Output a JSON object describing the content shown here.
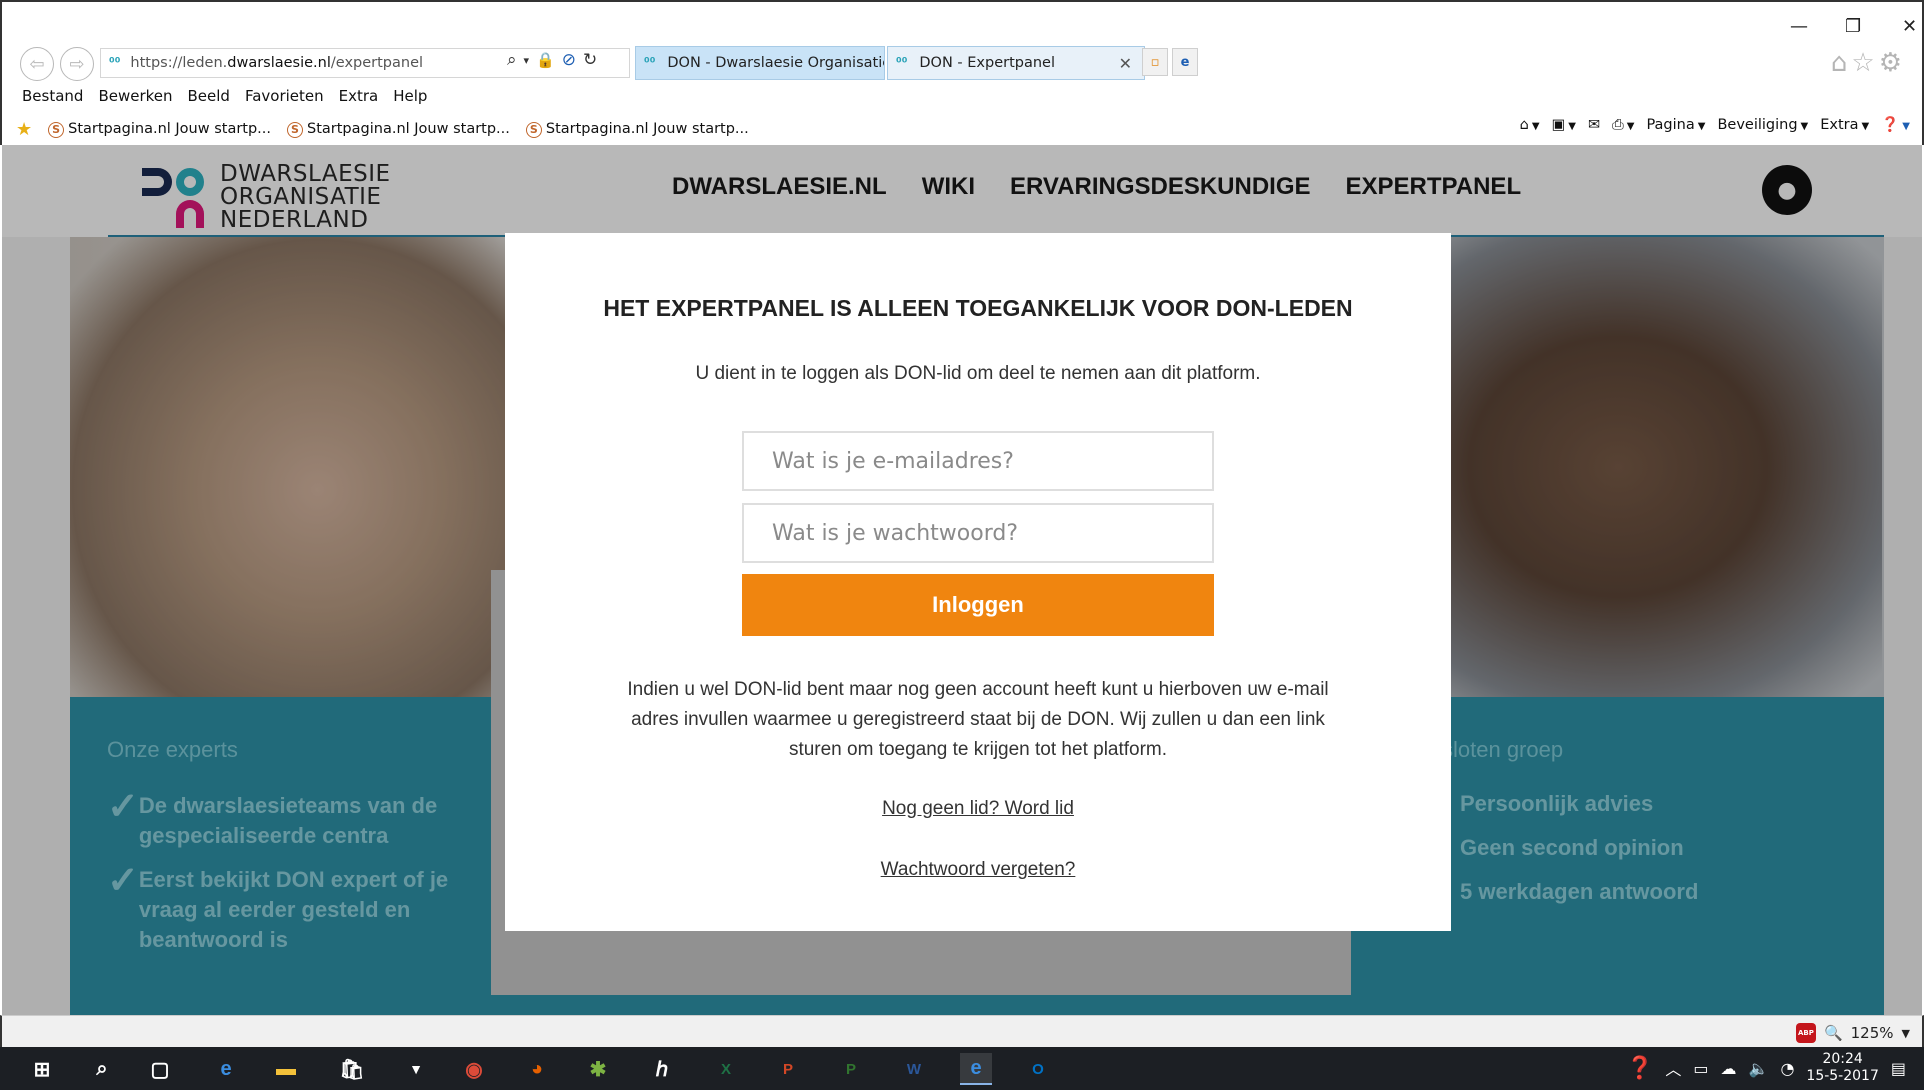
{
  "browser": {
    "url_prefix": "https://leden.",
    "url_host": "dwarslaesie.nl",
    "url_path": "/expertpanel",
    "tabs": [
      {
        "label": "DON - Dwarslaesie Organisatie..."
      },
      {
        "label": "DON - Expertpanel"
      }
    ],
    "menu": [
      "Bestand",
      "Bewerken",
      "Beeld",
      "Favorieten",
      "Extra",
      "Help"
    ],
    "favorites": [
      "Startpagina.nl  Jouw startp...",
      "Startpagina.nl  Jouw startp...",
      "Startpagina.nl  Jouw startp..."
    ],
    "commands": {
      "page": "Pagina",
      "security": "Beveiliging",
      "extra": "Extra"
    },
    "zoom": "125%"
  },
  "site": {
    "logo_lines": [
      "DWARSLAESIE",
      "ORGANISATIE",
      "NEDERLAND"
    ],
    "nav": [
      "DWARSLAESIE.NL",
      "WIKI",
      "ERVARINGSDESKUNDIGE",
      "EXPERTPANEL"
    ]
  },
  "background": {
    "left_title": "Onze experts",
    "left_items": [
      "De dwarslaesieteams van de gespecialiseerde centra",
      "Eerst bekijkt DON expert of je vraag al eerder gesteld en beantwoord is"
    ],
    "right_title_partial": "sloten groep",
    "right_items": [
      "Persoonlijk advies",
      "Geen second opinion",
      "5 werkdagen antwoord"
    ]
  },
  "modal": {
    "title": "HET EXPERTPANEL IS ALLEEN TOEGANKELIJK VOOR DON-LEDEN",
    "intro": "U dient in te loggen als DON-lid om deel te nemen aan dit platform.",
    "email_placeholder": "Wat is je e-mailadres?",
    "password_placeholder": "Wat is je wachtwoord?",
    "login_label": "Inloggen",
    "info": "Indien u wel DON-lid bent maar nog geen account heeft kunt u hierboven uw e-mail adres invullen waarmee u geregistreerd staat bij de DON. Wij zullen u dan een link sturen om toegang te krijgen tot het platform.",
    "register_link": "Nog geen lid? Word lid",
    "forgot_link": "Wachtwoord vergeten?"
  },
  "taskbar": {
    "time": "20:24",
    "date": "15-5-2017"
  }
}
